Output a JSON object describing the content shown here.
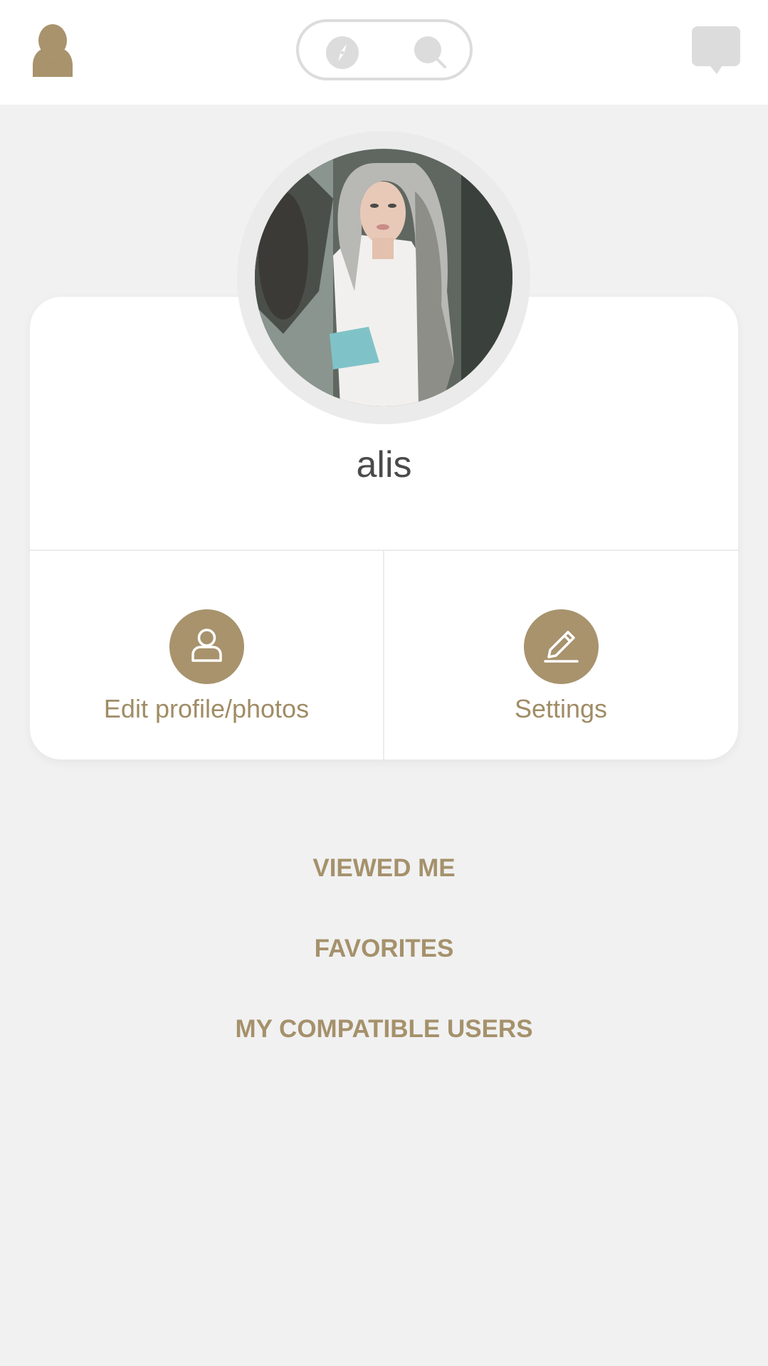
{
  "header": {
    "profile_icon": "user-silhouette-icon",
    "toggle": {
      "discover_icon": "compass-icon",
      "search_icon": "magnifier-icon"
    },
    "chat_icon": "chat-bubble-icon"
  },
  "profile": {
    "name": "alis",
    "avatar_alt": "alis"
  },
  "actions": {
    "edit": {
      "label": "Edit profile/photos",
      "icon": "person-outline-icon"
    },
    "settings": {
      "label": "Settings",
      "icon": "pencil-icon"
    }
  },
  "menu": {
    "viewed_me": "VIEWED ME",
    "favorites": "FAVORITES",
    "compatible": "MY COMPATIBLE USERS"
  },
  "colors": {
    "accent": "#a8936d",
    "accent_text": "#a08c66",
    "background": "#f1f1f1",
    "card": "#ffffff",
    "inactive_icon": "#dcdcdc",
    "name_text": "#4a4a4a"
  }
}
